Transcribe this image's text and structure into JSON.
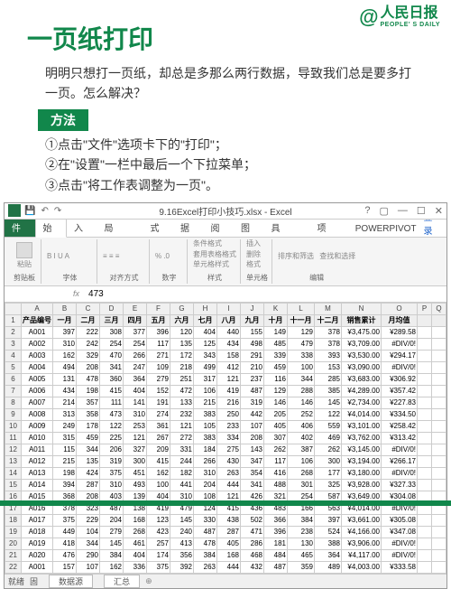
{
  "logo": {
    "at": "@",
    "cn": "人民日报",
    "en": "PEOPLE' S DAILY"
  },
  "title": "一页纸打印",
  "desc": "明明只想打一页纸，却总是多那么两行数据，导致我们总是要多打一页。怎么解决？",
  "method_label": "方法",
  "steps": [
    "①点击\"文件\"选项卡下的\"打印\"；",
    "②在\"设置\"一栏中最后一个下拉菜单；",
    "③点击\"将工作表调整为一页\"。"
  ],
  "excel": {
    "window_title": "9.16Excel打印小技巧.xlsx - Excel",
    "tabs": [
      "文件",
      "开始",
      "插入",
      "页面布局",
      "公式",
      "数据",
      "审阅",
      "视图",
      "开发工具",
      "加载项",
      "POWERPIVOT"
    ],
    "active_tab": "开始",
    "signin": "登录",
    "groups": {
      "clipboard": {
        "label": "剪贴板",
        "paste": "粘贴"
      },
      "font": "字体",
      "align": "对齐方式",
      "number": "数字",
      "styles": {
        "label": "样式",
        "a": "条件格式",
        "b": "套用表格格式",
        "c": "单元格样式"
      },
      "cells": {
        "label": "单元格",
        "a": "插入",
        "b": "删除",
        "c": "格式"
      },
      "editing": {
        "label": "编辑",
        "a": "排序和筛选",
        "b": "查找和选择"
      }
    },
    "namebox": "",
    "fx": "fx",
    "formula": "473",
    "ready": "就绪",
    "fixed": "固",
    "sheet": "数据源",
    "sheet2": "汇总",
    "colhdrs": [
      "",
      "A",
      "B",
      "C",
      "D",
      "E",
      "F",
      "G",
      "H",
      "I",
      "J",
      "K",
      "L",
      "M",
      "N",
      "O",
      "P",
      "Q"
    ],
    "row1": [
      "产品编号",
      "一月",
      "二月",
      "三月",
      "四月",
      "五月",
      "六月",
      "七月",
      "八月",
      "九月",
      "十月",
      "十一月",
      "十二月",
      "销售累计",
      "月均值",
      "",
      ""
    ],
    "rows": [
      [
        "A001",
        "397",
        "222",
        "308",
        "377",
        "396",
        "120",
        "404",
        "440",
        "155",
        "149",
        "129",
        "378",
        "¥3,475.00",
        "¥289.58",
        "",
        ""
      ],
      [
        "A002",
        "310",
        "242",
        "254",
        "254",
        "117",
        "135",
        "125",
        "434",
        "498",
        "485",
        "479",
        "378",
        "¥3,709.00",
        "#DIV/0!",
        "",
        ""
      ],
      [
        "A003",
        "162",
        "329",
        "470",
        "266",
        "271",
        "172",
        "343",
        "158",
        "291",
        "339",
        "338",
        "393",
        "¥3,530.00",
        "¥294.17",
        "",
        ""
      ],
      [
        "A004",
        "494",
        "208",
        "341",
        "247",
        "109",
        "218",
        "499",
        "412",
        "210",
        "459",
        "100",
        "153",
        "¥3,090.00",
        "#DIV/0!",
        "",
        ""
      ],
      [
        "A005",
        "131",
        "478",
        "360",
        "364",
        "279",
        "251",
        "317",
        "121",
        "237",
        "116",
        "344",
        "285",
        "¥3,683.00",
        "¥306.92",
        "",
        ""
      ],
      [
        "A006",
        "434",
        "198",
        "415",
        "404",
        "152",
        "472",
        "106",
        "419",
        "487",
        "129",
        "288",
        "385",
        "¥4,289.00",
        "¥357.42",
        "",
        ""
      ],
      [
        "A007",
        "214",
        "357",
        "111",
        "141",
        "191",
        "133",
        "215",
        "216",
        "319",
        "146",
        "146",
        "145",
        "¥2,734.00",
        "¥227.83",
        "",
        ""
      ],
      [
        "A008",
        "313",
        "358",
        "473",
        "310",
        "274",
        "232",
        "383",
        "250",
        "442",
        "205",
        "252",
        "122",
        "¥4,014.00",
        "¥334.50",
        "",
        ""
      ],
      [
        "A009",
        "249",
        "178",
        "122",
        "253",
        "361",
        "121",
        "105",
        "233",
        "107",
        "405",
        "406",
        "559",
        "¥3,101.00",
        "¥258.42",
        "",
        ""
      ],
      [
        "A010",
        "315",
        "459",
        "225",
        "121",
        "267",
        "272",
        "383",
        "334",
        "208",
        "307",
        "402",
        "469",
        "¥3,762.00",
        "¥313.42",
        "",
        ""
      ],
      [
        "A011",
        "115",
        "344",
        "206",
        "327",
        "209",
        "331",
        "184",
        "275",
        "143",
        "262",
        "387",
        "262",
        "¥3,145.00",
        "#DIV/0!",
        "",
        ""
      ],
      [
        "A012",
        "215",
        "135",
        "319",
        "300",
        "415",
        "244",
        "266",
        "430",
        "347",
        "117",
        "106",
        "300",
        "¥3,194.00",
        "¥266.17",
        "",
        ""
      ],
      [
        "A013",
        "198",
        "424",
        "375",
        "451",
        "162",
        "182",
        "310",
        "263",
        "354",
        "416",
        "268",
        "177",
        "¥3,180.00",
        "#DIV/0!",
        "",
        ""
      ],
      [
        "A014",
        "394",
        "287",
        "310",
        "493",
        "100",
        "441",
        "204",
        "444",
        "341",
        "488",
        "301",
        "325",
        "¥3,928.00",
        "¥327.33",
        "",
        ""
      ],
      [
        "A015",
        "368",
        "208",
        "403",
        "139",
        "404",
        "310",
        "108",
        "121",
        "426",
        "321",
        "254",
        "587",
        "¥3,649.00",
        "¥304.08",
        "",
        ""
      ],
      [
        "A016",
        "378",
        "323",
        "487",
        "138",
        "419",
        "479",
        "124",
        "415",
        "436",
        "483",
        "166",
        "563",
        "¥4,014.00",
        "#DIV/0!",
        "",
        ""
      ],
      [
        "A017",
        "375",
        "229",
        "204",
        "168",
        "123",
        "145",
        "330",
        "438",
        "502",
        "366",
        "384",
        "397",
        "¥3,661.00",
        "¥305.08",
        "",
        ""
      ],
      [
        "A018",
        "449",
        "104",
        "279",
        "268",
        "423",
        "240",
        "487",
        "287",
        "471",
        "396",
        "238",
        "524",
        "¥4,166.00",
        "¥347.08",
        "",
        ""
      ],
      [
        "A019",
        "418",
        "344",
        "145",
        "461",
        "257",
        "413",
        "478",
        "405",
        "286",
        "181",
        "130",
        "388",
        "¥3,906.00",
        "#DIV/0!",
        "",
        ""
      ],
      [
        "A020",
        "476",
        "290",
        "384",
        "404",
        "174",
        "356",
        "384",
        "168",
        "468",
        "484",
        "465",
        "364",
        "¥4,117.00",
        "#DIV/0!",
        "",
        ""
      ],
      [
        "A001",
        "157",
        "107",
        "162",
        "336",
        "375",
        "392",
        "263",
        "444",
        "432",
        "487",
        "359",
        "489",
        "¥4,003.00",
        "¥333.58",
        "",
        ""
      ]
    ]
  }
}
